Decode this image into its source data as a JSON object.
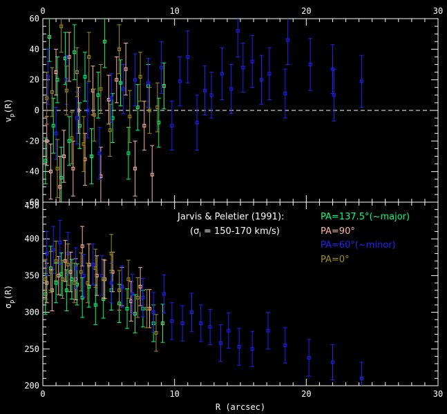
{
  "chart_data": [
    {
      "type": "scatter",
      "panel": "top",
      "ylabel_main": "v",
      "ylabel_sub": "p",
      "ylabel_tail": "(R)",
      "xlim": [
        0,
        30
      ],
      "ylim": [
        -60,
        60
      ],
      "xticks_top": [
        "0",
        "10",
        "20",
        "30"
      ],
      "yticks": [
        "-60",
        "-40",
        "-20",
        "0",
        "20",
        "40",
        "60"
      ],
      "zero_line": true,
      "series": [
        {
          "name": "PA=137.5°(~major)",
          "color": "#00ff7f",
          "points": [
            {
              "x": 0.2,
              "y": -33,
              "err": 15
            },
            {
              "x": 0.5,
              "y": 48,
              "err": 16
            },
            {
              "x": 0.8,
              "y": -10,
              "err": 18
            },
            {
              "x": 1.1,
              "y": 20,
              "err": 15
            },
            {
              "x": 1.4,
              "y": -44,
              "err": 20
            },
            {
              "x": 1.7,
              "y": 34,
              "err": 17
            },
            {
              "x": 2.0,
              "y": -20,
              "err": 16
            },
            {
              "x": 2.4,
              "y": 38,
              "err": 18
            },
            {
              "x": 2.8,
              "y": -10,
              "err": 15
            },
            {
              "x": 3.2,
              "y": 22,
              "err": 16
            },
            {
              "x": 3.7,
              "y": -30,
              "err": 18
            },
            {
              "x": 4.2,
              "y": 10,
              "err": 15
            },
            {
              "x": 4.7,
              "y": 45,
              "err": 17
            },
            {
              "x": 5.3,
              "y": -5,
              "err": 16
            },
            {
              "x": 5.9,
              "y": 18,
              "err": 15
            },
            {
              "x": 6.5,
              "y": -28,
              "err": 17
            },
            {
              "x": 7.2,
              "y": 2,
              "err": 15
            },
            {
              "x": 8.0,
              "y": 16,
              "err": 14
            },
            {
              "x": 8.8,
              "y": -8,
              "err": 16
            },
            {
              "x": 9.2,
              "y": 16,
              "err": 15
            }
          ]
        },
        {
          "name": "PA=90°",
          "color": "#ffb6a0",
          "points": [
            {
              "x": 0.3,
              "y": -20,
              "err": 16
            },
            {
              "x": 0.6,
              "y": -40,
              "err": 18
            },
            {
              "x": 1.0,
              "y": 25,
              "err": 15
            },
            {
              "x": 1.3,
              "y": -50,
              "err": 20
            },
            {
              "x": 1.6,
              "y": -30,
              "err": 17
            },
            {
              "x": 2.0,
              "y": 35,
              "err": 16
            },
            {
              "x": 2.3,
              "y": -38,
              "err": 18
            },
            {
              "x": 2.7,
              "y": 0,
              "err": 15
            },
            {
              "x": 3.2,
              "y": -32,
              "err": 17
            },
            {
              "x": 3.8,
              "y": 13,
              "err": 16
            },
            {
              "x": 4.4,
              "y": -43,
              "err": 19
            },
            {
              "x": 5.0,
              "y": 7,
              "err": 16
            },
            {
              "x": 5.6,
              "y": 20,
              "err": 15
            },
            {
              "x": 6.3,
              "y": 27,
              "err": 17
            },
            {
              "x": 7.0,
              "y": -38,
              "err": 18
            },
            {
              "x": 7.7,
              "y": -10,
              "err": 16
            },
            {
              "x": 8.3,
              "y": -42,
              "err": 19
            }
          ]
        },
        {
          "name": "PA=60°(~minor)",
          "color": "#2020ff",
          "points": [
            {
              "x": 0.4,
              "y": 22,
              "err": 18
            },
            {
              "x": 1.0,
              "y": -15,
              "err": 17
            },
            {
              "x": 1.8,
              "y": 20,
              "err": 16
            },
            {
              "x": 2.6,
              "y": -5,
              "err": 17
            },
            {
              "x": 3.4,
              "y": 0,
              "err": 18
            },
            {
              "x": 4.3,
              "y": -28,
              "err": 17
            },
            {
              "x": 5.2,
              "y": 8,
              "err": 16
            },
            {
              "x": 6.1,
              "y": 14,
              "err": 16
            },
            {
              "x": 7.0,
              "y": 20,
              "err": 17
            },
            {
              "x": 8.0,
              "y": 18,
              "err": 16
            },
            {
              "x": 9.0,
              "y": 28,
              "err": 17
            },
            {
              "x": 9.8,
              "y": -10,
              "err": 16
            },
            {
              "x": 10.4,
              "y": 19,
              "err": 16
            },
            {
              "x": 11.0,
              "y": 35,
              "err": 17
            },
            {
              "x": 11.7,
              "y": -8,
              "err": 18
            },
            {
              "x": 12.3,
              "y": 13,
              "err": 16
            },
            {
              "x": 12.8,
              "y": 10,
              "err": 15
            },
            {
              "x": 13.6,
              "y": 24,
              "err": 17
            },
            {
              "x": 14.3,
              "y": 14,
              "err": 16
            },
            {
              "x": 14.8,
              "y": 52,
              "err": 17
            },
            {
              "x": 15.2,
              "y": 28,
              "err": 16
            },
            {
              "x": 15.9,
              "y": 32,
              "err": 17
            },
            {
              "x": 16.6,
              "y": 20,
              "err": 16
            },
            {
              "x": 17.2,
              "y": 24,
              "err": 17
            },
            {
              "x": 18.4,
              "y": 11,
              "err": 16
            },
            {
              "x": 18.6,
              "y": 46,
              "err": 16
            },
            {
              "x": 20.3,
              "y": 30,
              "err": 17
            },
            {
              "x": 22.0,
              "y": 27,
              "err": 16
            },
            {
              "x": 22.1,
              "y": 10,
              "err": 17
            },
            {
              "x": 24.2,
              "y": 19,
              "err": 17
            }
          ]
        },
        {
          "name": "PA=0°",
          "color": "#a09018",
          "points": [
            {
              "x": 0.3,
              "y": 8,
              "err": 17
            },
            {
              "x": 0.7,
              "y": 12,
              "err": 16
            },
            {
              "x": 1.1,
              "y": -38,
              "err": 19
            },
            {
              "x": 1.4,
              "y": 55,
              "err": 17
            },
            {
              "x": 1.8,
              "y": 13,
              "err": 16
            },
            {
              "x": 2.2,
              "y": -18,
              "err": 17
            },
            {
              "x": 2.6,
              "y": 25,
              "err": 16
            },
            {
              "x": 3.1,
              "y": -22,
              "err": 18
            },
            {
              "x": 3.5,
              "y": 35,
              "err": 16
            },
            {
              "x": 3.9,
              "y": -3,
              "err": 17
            },
            {
              "x": 4.4,
              "y": 14,
              "err": 16
            },
            {
              "x": 5.1,
              "y": -13,
              "err": 17
            },
            {
              "x": 5.8,
              "y": 40,
              "err": 16
            },
            {
              "x": 6.6,
              "y": -4,
              "err": 17
            },
            {
              "x": 7.4,
              "y": 22,
              "err": 16
            },
            {
              "x": 8.1,
              "y": 0,
              "err": 15
            },
            {
              "x": 8.7,
              "y": 2,
              "err": 16
            }
          ]
        }
      ]
    },
    {
      "type": "scatter",
      "panel": "bottom",
      "ylabel_main": "σ",
      "ylabel_sub": "p",
      "ylabel_tail": "(R)",
      "xlabel": "R (arcsec)",
      "xlim": [
        0,
        30
      ],
      "ylim": [
        200,
        450
      ],
      "xticks_bottom": [
        "0",
        "10",
        "20",
        "30"
      ],
      "yticks": [
        "200",
        "250",
        "300",
        "350",
        "400",
        "450"
      ],
      "series": [
        {
          "name": "PA=137.5°(~major)",
          "color": "#00ff7f",
          "points": [
            {
              "x": 0.2,
              "y": 325,
              "err": 28
            },
            {
              "x": 0.6,
              "y": 360,
              "err": 30
            },
            {
              "x": 1.0,
              "y": 340,
              "err": 27
            },
            {
              "x": 1.4,
              "y": 352,
              "err": 29
            },
            {
              "x": 1.8,
              "y": 330,
              "err": 28
            },
            {
              "x": 2.2,
              "y": 345,
              "err": 27
            },
            {
              "x": 2.6,
              "y": 338,
              "err": 28
            },
            {
              "x": 3.0,
              "y": 320,
              "err": 27
            },
            {
              "x": 3.5,
              "y": 335,
              "err": 28
            },
            {
              "x": 4.0,
              "y": 310,
              "err": 27
            },
            {
              "x": 4.6,
              "y": 318,
              "err": 26
            },
            {
              "x": 5.2,
              "y": 330,
              "err": 27
            },
            {
              "x": 5.8,
              "y": 312,
              "err": 26
            },
            {
              "x": 6.4,
              "y": 305,
              "err": 27
            },
            {
              "x": 7.0,
              "y": 298,
              "err": 26
            },
            {
              "x": 7.6,
              "y": 305,
              "err": 25
            },
            {
              "x": 8.4,
              "y": 285,
              "err": 25
            },
            {
              "x": 9.1,
              "y": 285,
              "err": 26
            }
          ]
        },
        {
          "name": "PA=90°",
          "color": "#ffb6a0",
          "points": [
            {
              "x": 0.3,
              "y": 340,
              "err": 27
            },
            {
              "x": 0.7,
              "y": 330,
              "err": 28
            },
            {
              "x": 1.2,
              "y": 350,
              "err": 26
            },
            {
              "x": 1.7,
              "y": 370,
              "err": 28
            },
            {
              "x": 2.1,
              "y": 355,
              "err": 27
            },
            {
              "x": 2.5,
              "y": 345,
              "err": 28
            },
            {
              "x": 3.0,
              "y": 390,
              "err": 27
            },
            {
              "x": 3.5,
              "y": 365,
              "err": 28
            },
            {
              "x": 4.1,
              "y": 350,
              "err": 27
            },
            {
              "x": 4.7,
              "y": 345,
              "err": 26
            },
            {
              "x": 5.3,
              "y": 355,
              "err": 27
            },
            {
              "x": 6.0,
              "y": 335,
              "err": 26
            },
            {
              "x": 6.7,
              "y": 315,
              "err": 27
            },
            {
              "x": 7.4,
              "y": 335,
              "err": 26
            },
            {
              "x": 8.1,
              "y": 305,
              "err": 26
            }
          ]
        },
        {
          "name": "PA=60°(~minor)",
          "color": "#2020ff",
          "points": [
            {
              "x": 0.3,
              "y": 380,
              "err": 30
            },
            {
              "x": 0.8,
              "y": 385,
              "err": 32
            },
            {
              "x": 1.3,
              "y": 395,
              "err": 30
            },
            {
              "x": 1.9,
              "y": 380,
              "err": 29
            },
            {
              "x": 2.5,
              "y": 360,
              "err": 28
            },
            {
              "x": 3.1,
              "y": 350,
              "err": 29
            },
            {
              "x": 3.8,
              "y": 365,
              "err": 28
            },
            {
              "x": 4.5,
              "y": 350,
              "err": 27
            },
            {
              "x": 5.2,
              "y": 340,
              "err": 27
            },
            {
              "x": 6.0,
              "y": 335,
              "err": 28
            },
            {
              "x": 6.8,
              "y": 325,
              "err": 27
            },
            {
              "x": 7.6,
              "y": 320,
              "err": 26
            },
            {
              "x": 8.4,
              "y": 300,
              "err": 27
            },
            {
              "x": 9.2,
              "y": 325,
              "err": 26
            },
            {
              "x": 9.8,
              "y": 288,
              "err": 25
            },
            {
              "x": 10.6,
              "y": 285,
              "err": 24
            },
            {
              "x": 11.3,
              "y": 300,
              "err": 26
            },
            {
              "x": 12.0,
              "y": 285,
              "err": 25
            },
            {
              "x": 12.7,
              "y": 280,
              "err": 24
            },
            {
              "x": 13.5,
              "y": 258,
              "err": 25
            },
            {
              "x": 14.1,
              "y": 275,
              "err": 24
            },
            {
              "x": 14.9,
              "y": 253,
              "err": 25
            },
            {
              "x": 15.9,
              "y": 250,
              "err": 24
            },
            {
              "x": 17.1,
              "y": 275,
              "err": 25
            },
            {
              "x": 18.4,
              "y": 255,
              "err": 24
            },
            {
              "x": 20.2,
              "y": 238,
              "err": 25
            },
            {
              "x": 22.0,
              "y": 232,
              "err": 24
            },
            {
              "x": 24.2,
              "y": 210,
              "err": 22
            }
          ]
        },
        {
          "name": "PA=0°",
          "color": "#a09018",
          "points": [
            {
              "x": 0.2,
              "y": 345,
              "err": 27
            },
            {
              "x": 0.6,
              "y": 355,
              "err": 28
            },
            {
              "x": 1.0,
              "y": 370,
              "err": 27
            },
            {
              "x": 1.5,
              "y": 345,
              "err": 26
            },
            {
              "x": 1.9,
              "y": 365,
              "err": 28
            },
            {
              "x": 2.4,
              "y": 340,
              "err": 27
            },
            {
              "x": 2.9,
              "y": 355,
              "err": 26
            },
            {
              "x": 3.4,
              "y": 340,
              "err": 27
            },
            {
              "x": 4.0,
              "y": 360,
              "err": 26
            },
            {
              "x": 4.6,
              "y": 345,
              "err": 27
            },
            {
              "x": 5.2,
              "y": 380,
              "err": 26
            },
            {
              "x": 5.8,
              "y": 330,
              "err": 27
            },
            {
              "x": 6.5,
              "y": 345,
              "err": 26
            },
            {
              "x": 7.2,
              "y": 320,
              "err": 27
            },
            {
              "x": 7.9,
              "y": 305,
              "err": 26
            },
            {
              "x": 8.6,
              "y": 272,
              "err": 25
            }
          ]
        }
      ]
    }
  ],
  "annotation": {
    "line1": "Jarvis & Peletier (1991):",
    "line2_open": "(σ",
    "line2_sub": "i",
    "line2_rest": " = 150-170 km/s)"
  },
  "legend": [
    {
      "label": "PA=137.5°(~major)",
      "color": "#00ff7f"
    },
    {
      "label": "PA=90°",
      "color": "#ffb6a0"
    },
    {
      "label": "PA=60°(~minor)",
      "color": "#2020ff"
    },
    {
      "label": "PA=0°",
      "color": "#a09018"
    }
  ]
}
